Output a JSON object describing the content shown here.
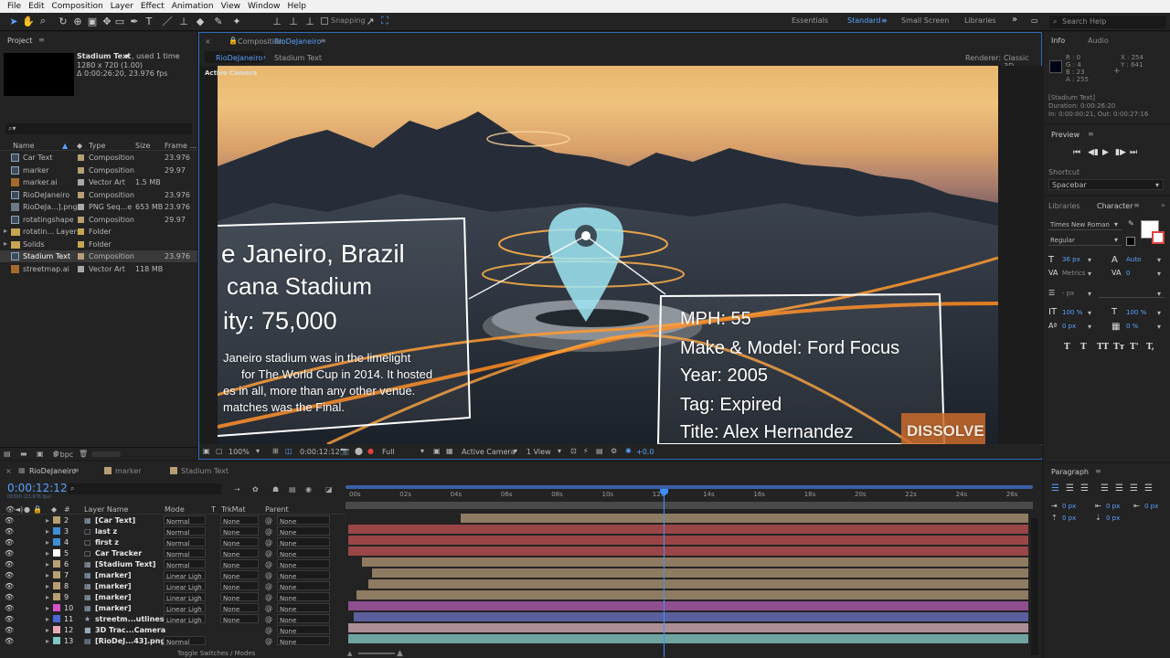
{
  "menu": [
    "File",
    "Edit",
    "Composition",
    "Layer",
    "Effect",
    "Animation",
    "View",
    "Window",
    "Help"
  ],
  "toolbar": {
    "snapping": "Snapping"
  },
  "workspaces": [
    "Essentials",
    "Standard",
    "Small Screen",
    "Libraries"
  ],
  "search_help": {
    "placeholder": "Search Help"
  },
  "project": {
    "tab": "Project",
    "selected_name": "Stadium Text",
    "used": ", used 1 time",
    "dims": "1280 x 720 (1.00)",
    "duration": "Δ 0:00:26:20, 23.976 fps",
    "search_placeholder": "",
    "columns": [
      "Name",
      "Type",
      "Size",
      "Frame ..."
    ],
    "items": [
      {
        "name": "Car Text",
        "type": "Composition",
        "size": "",
        "frame": "23.976"
      },
      {
        "name": "marker",
        "type": "Composition",
        "size": "",
        "frame": "29.97"
      },
      {
        "name": "marker.ai",
        "type": "Vector Art",
        "size": "1.5 MB",
        "frame": ""
      },
      {
        "name": "RioDeJaneiro",
        "type": "Composition",
        "size": "",
        "frame": "23.976"
      },
      {
        "name": "RioDeJa...].png",
        "type": "PNG Seq...e",
        "size": "653 MB",
        "frame": "23.976"
      },
      {
        "name": "rotatingshape",
        "type": "Composition",
        "size": "",
        "frame": "29.97"
      },
      {
        "name": "rotatin... Layers",
        "type": "Folder",
        "size": "",
        "frame": ""
      },
      {
        "name": "Solids",
        "type": "Folder",
        "size": "",
        "frame": ""
      },
      {
        "name": "Stadium Text",
        "type": "Composition",
        "size": "",
        "frame": "23.976"
      },
      {
        "name": "streetmap.ai",
        "type": "Vector Art",
        "size": "118 MB",
        "frame": ""
      }
    ],
    "bpc": "8 bpc"
  },
  "composition": {
    "tab_prefix": "Composition",
    "tab_name": "RioDeJaneiro",
    "breadcrumb": [
      "RioDeJaneiro",
      "Stadium Text"
    ],
    "renderer_label": "Renderer:",
    "renderer": "Classic 3D",
    "active_camera": "Active Camera",
    "overlay_left": [
      "e Janeiro, Brazil",
      "cana Stadium",
      "ity: 75,000",
      "Janeiro stadium was in the limelight",
      "for The World Cup in 2014. It hosted",
      "es in all, more than any other venue.",
      "matches was the Final."
    ],
    "overlay_right": [
      "MPH: 55",
      "Make & Model: Ford Focus",
      "Year: 2005",
      "Tag: Expired",
      "Title: Alex Hernandez"
    ],
    "watermark": "DISSOLVE",
    "footer": {
      "zoom": "100%",
      "timecode": "0:00:12:12",
      "resolution": "Full",
      "camera": "Active Camera",
      "views": "1 View",
      "exposure": "+0.0"
    }
  },
  "info": {
    "tab_info": "Info",
    "tab_audio": "Audio",
    "r": "R : 0",
    "g": "G : 4",
    "b": "B : 23",
    "a": "A : 255",
    "x": "X : 254",
    "y": "Y : 641",
    "layer": "[Stadium Text]",
    "duration": "Duration: 0:00:26:20",
    "inout": "In: 0:00:00:21, Out: 0:00:27:16",
    "swatch": "#000417"
  },
  "preview": {
    "title": "Preview",
    "shortcut_label": "Shortcut",
    "shortcut": "Spacebar"
  },
  "character": {
    "tab_libraries": "Libraries",
    "tab_character": "Character",
    "font": "Times New Roman",
    "style": "Regular",
    "size": "36 px",
    "leading": "Auto",
    "kerning": "Metrics",
    "tracking": "0",
    "stroke": "- px",
    "vscale": "100 %",
    "hscale": "100 %",
    "baseline": "0 px",
    "tsume": "0 %",
    "styles": [
      "T",
      "T",
      "TT",
      "Tт",
      "T'",
      "T,"
    ]
  },
  "paragraph": {
    "title": "Paragraph",
    "indent": [
      "0 px",
      "0 px",
      "0 px",
      "0 px",
      "0 px"
    ]
  },
  "timeline": {
    "tabs": [
      "RioDeJaneiro",
      "marker",
      "Stadium Text"
    ],
    "timecode": "0:00:12:12",
    "timecode_sub": "00300 (23.976 fps)",
    "columns": {
      "layer_name": "Layer Name",
      "mode": "Mode",
      "t": "T",
      "trkmat": "TrkMat",
      "parent": "Parent",
      "num": "#"
    },
    "ruler": [
      "00s",
      "02s",
      "04s",
      "06s",
      "08s",
      "10s",
      "12s",
      "14s",
      "16s",
      "18s",
      "20s",
      "22s",
      "24s",
      "26s"
    ],
    "layers": [
      {
        "num": "2",
        "name": "[Car Text]",
        "color": "#b79e73",
        "mode": "Normal",
        "trk": "None",
        "parent": "None",
        "icon": "comp",
        "bar": "#8f7b62",
        "start": 0.165,
        "end": 1.0
      },
      {
        "num": "3",
        "name": "last z",
        "color": "#3d8fd6",
        "mode": "Normal",
        "trk": "None",
        "parent": "None",
        "icon": "null",
        "bar": "#9a4646",
        "start": 0,
        "end": 1.0
      },
      {
        "num": "4",
        "name": "first z",
        "color": "#3d8fd6",
        "mode": "Normal",
        "trk": "None",
        "parent": "None",
        "icon": "null",
        "bar": "#9a4646",
        "start": 0,
        "end": 1.0
      },
      {
        "num": "5",
        "name": "Car Tracker",
        "color": "#ffffff",
        "mode": "Normal",
        "trk": "None",
        "parent": "None",
        "icon": "null",
        "bar": "#9a4646",
        "start": 0,
        "end": 1.0
      },
      {
        "num": "6",
        "name": "[Stadium Text]",
        "color": "#b79e73",
        "mode": "Normal",
        "trk": "None",
        "parent": "None",
        "icon": "comp",
        "bar": "#8f7b62",
        "start": 0.02,
        "end": 1.0
      },
      {
        "num": "7",
        "name": "[marker]",
        "color": "#b79e73",
        "mode": "Linear Ligh",
        "trk": "None",
        "parent": "None",
        "icon": "comp",
        "bar": "#8f7b62",
        "start": 0.035,
        "end": 1.0
      },
      {
        "num": "8",
        "name": "[marker]",
        "color": "#b79e73",
        "mode": "Linear Ligh",
        "trk": "None",
        "parent": "None",
        "icon": "comp",
        "bar": "#8f7b62",
        "start": 0.03,
        "end": 1.0
      },
      {
        "num": "9",
        "name": "[marker]",
        "color": "#b79e73",
        "mode": "Linear Ligh",
        "trk": "None",
        "parent": "None",
        "icon": "comp",
        "bar": "#8f7b62",
        "start": 0.012,
        "end": 1.0
      },
      {
        "num": "10",
        "name": "[marker]",
        "color": "#d652c8",
        "mode": "Linear Ligh",
        "trk": "None",
        "parent": "None",
        "icon": "comp",
        "bar": "#8e4f8e",
        "start": 0,
        "end": 1.0
      },
      {
        "num": "11",
        "name": "streetm...utlines",
        "color": "#4a6ad6",
        "mode": "Linear Ligh",
        "trk": "None",
        "parent": "None",
        "icon": "shape",
        "bar": "#5b5f9e",
        "start": 0.008,
        "end": 1.0
      },
      {
        "num": "12",
        "name": "3D Trac...Camera",
        "color": "#e9a9b4",
        "mode": "",
        "trk": "",
        "parent": "None",
        "icon": "camera",
        "bar": "#ab8e94",
        "start": 0,
        "end": 1.0
      },
      {
        "num": "13",
        "name": "[RioDeJ...43].png]",
        "color": "#7fc6c6",
        "mode": "Normal",
        "trk": "",
        "parent": "None",
        "icon": "png",
        "bar": "#6fa4a0",
        "start": 0,
        "end": 1.0
      }
    ],
    "toggle_label": "Toggle Switches / Modes",
    "playhead_fraction": 0.463
  }
}
